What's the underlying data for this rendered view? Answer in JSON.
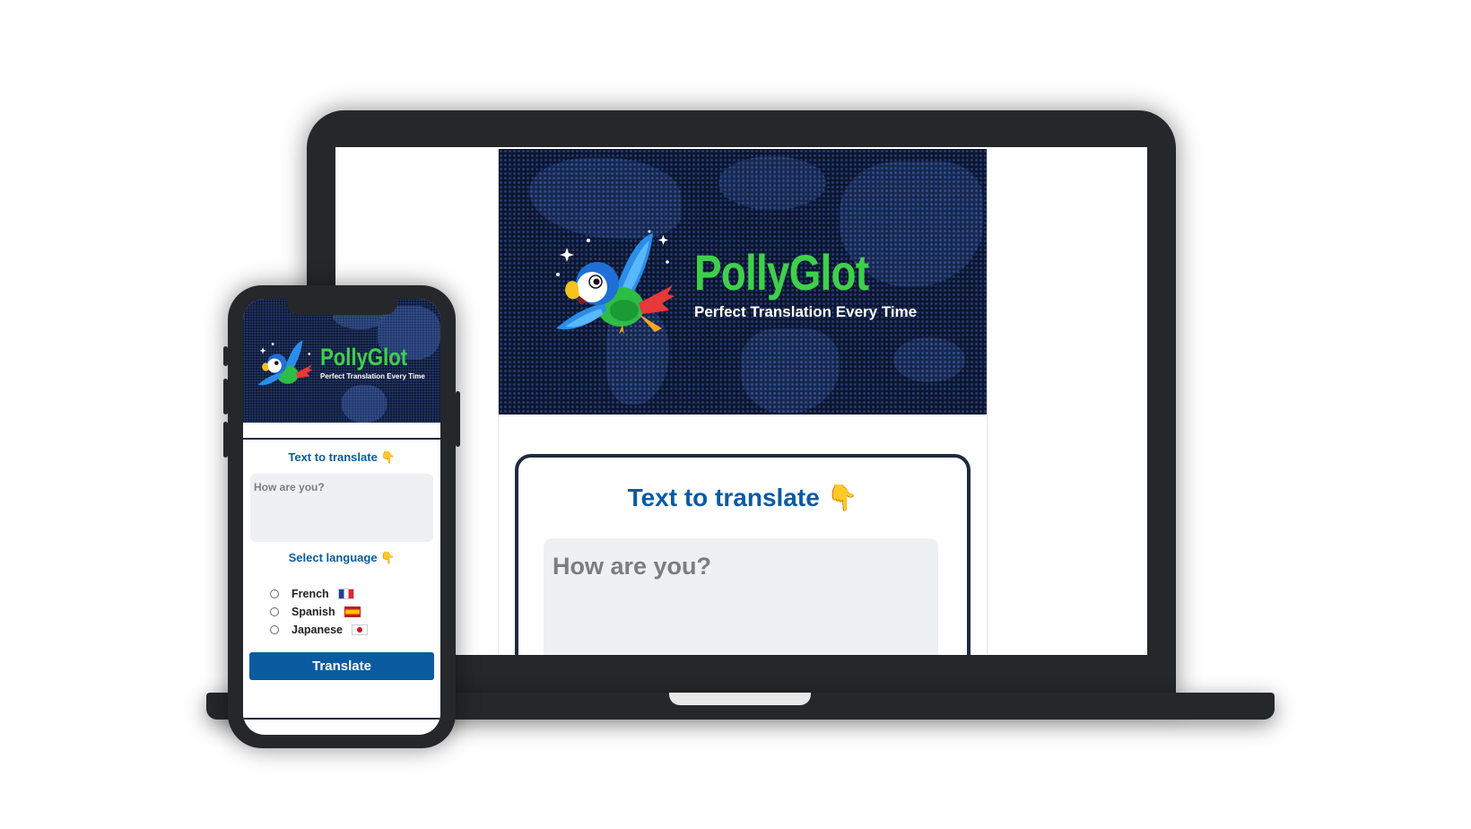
{
  "app": {
    "brand": "PollyGlot",
    "tagline": "Perfect Translation Every Time"
  },
  "translate_form": {
    "heading": "Text to translate",
    "heading_emoji": "👇",
    "input_placeholder": "How are you?"
  },
  "language_section": {
    "heading": "Select language",
    "heading_emoji": "👇",
    "options": [
      {
        "label": "French",
        "flag_icon": "france-flag-icon"
      },
      {
        "label": "Spanish",
        "flag_icon": "spain-flag-icon"
      },
      {
        "label": "Japanese",
        "flag_icon": "japan-flag-icon"
      }
    ]
  },
  "actions": {
    "translate_label": "Translate"
  },
  "colors": {
    "brand_green": "#3fd04a",
    "accent_blue": "#0b5ba1",
    "hero_navy": "#0c1631",
    "device_frame": "#25272b"
  }
}
